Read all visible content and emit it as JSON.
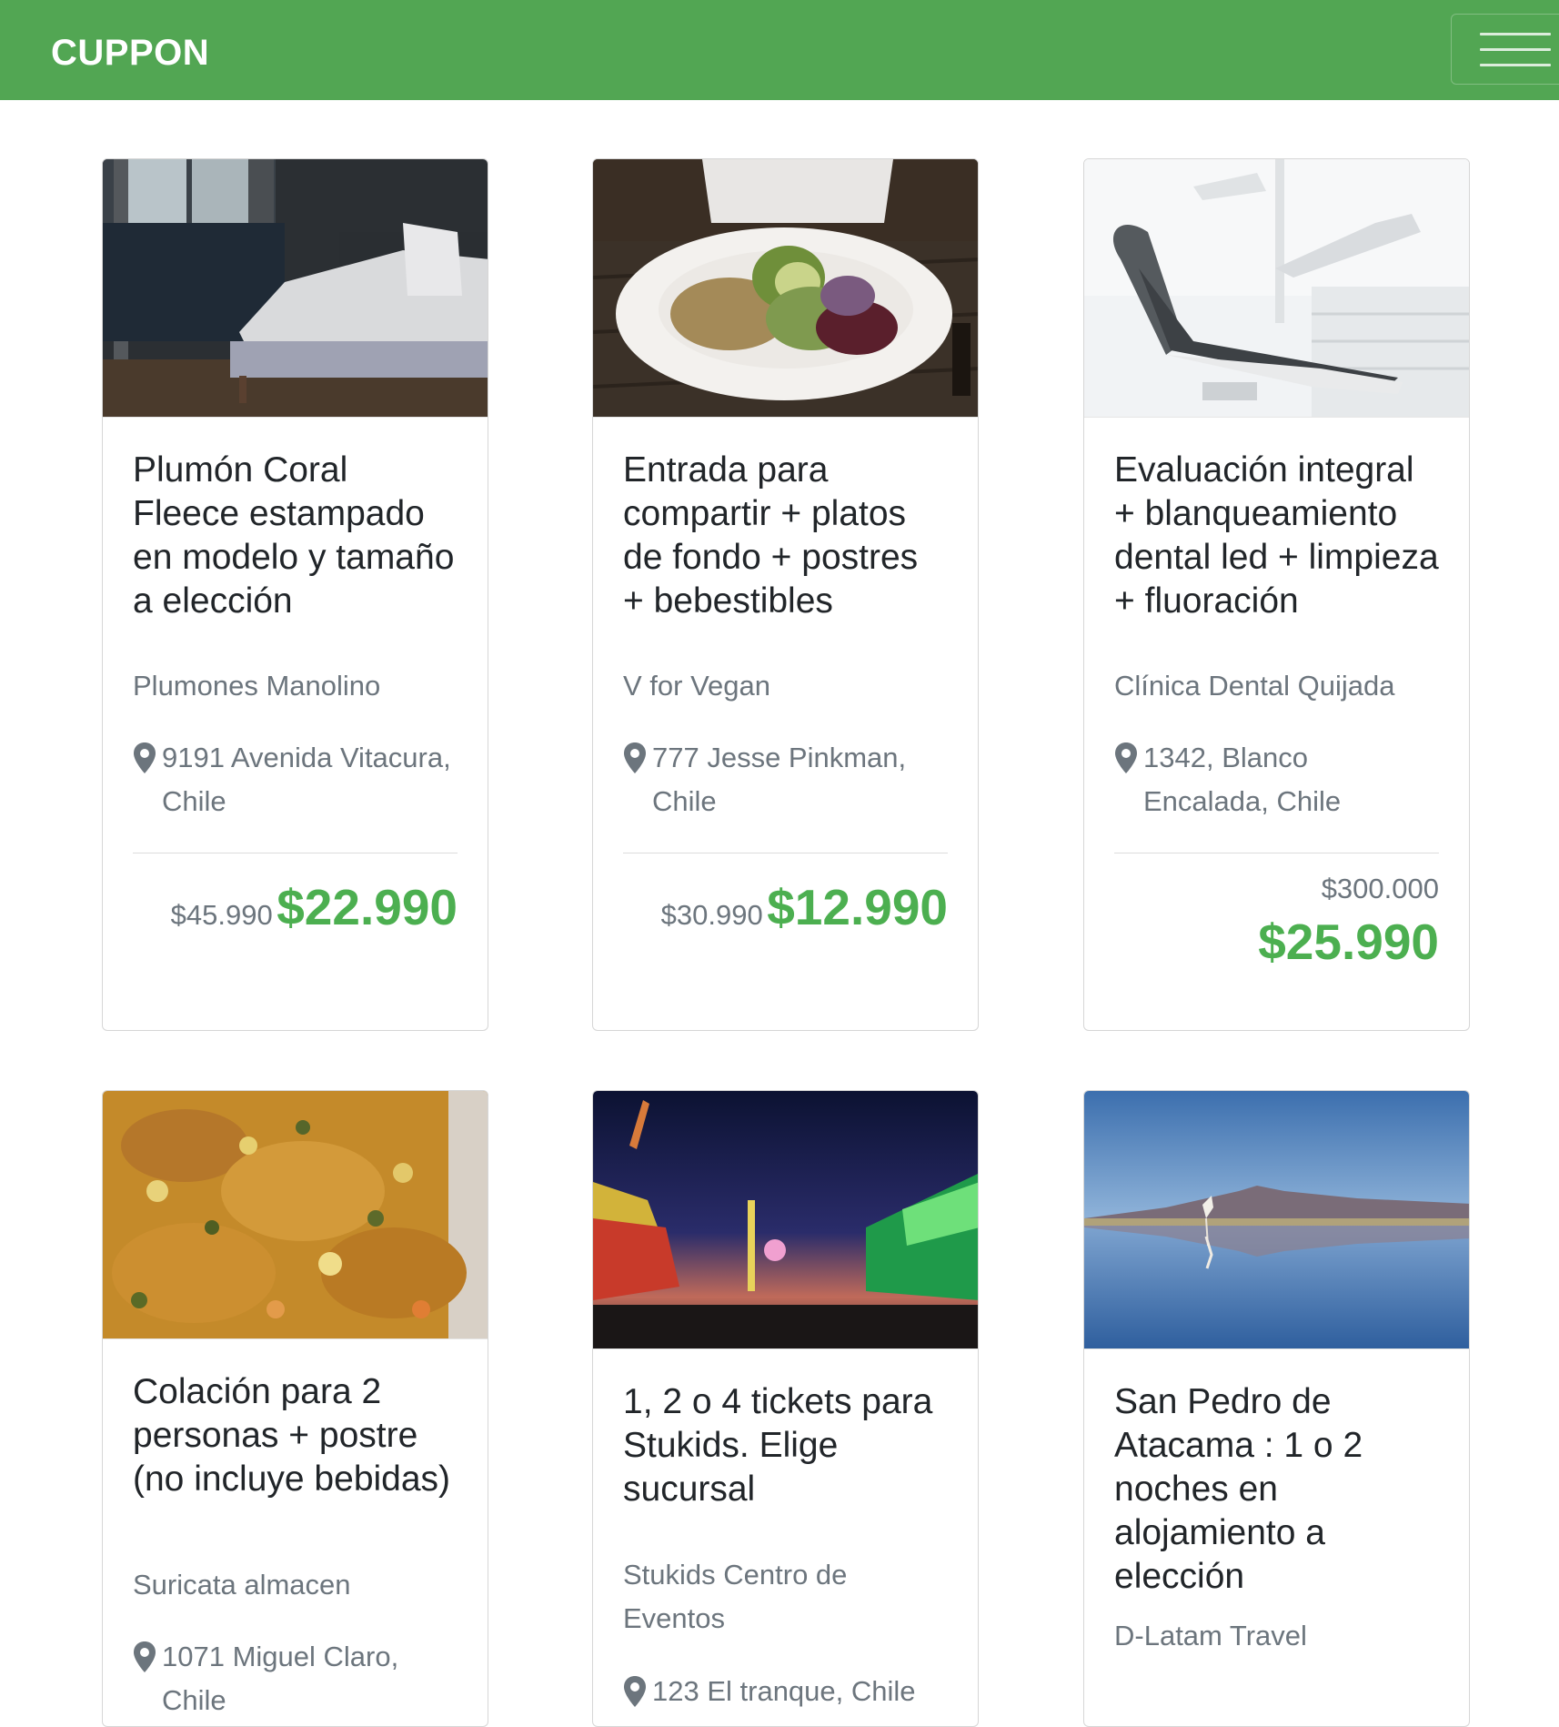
{
  "navbar": {
    "brand": "CUPPON",
    "menu_icon": "hamburger-icon",
    "color": "#52a653"
  },
  "accent_color": "#4caf50",
  "cards": [
    {
      "image": "bedroom-photo",
      "title": "Plumón Coral Fleece estampado en modelo y tamaño a elección",
      "merchant": "Plumones Manolino",
      "address": "9191 Avenida Vitacura, Chile",
      "old_price": "$45.990",
      "new_price": "$22.990"
    },
    {
      "image": "vegan-food-photo",
      "title": "Entrada para compartir + platos de fondo + postres + bebestibles",
      "merchant": "V for Vegan",
      "address": "777 Jesse Pinkman, Chile",
      "old_price": "$30.990",
      "new_price": "$12.990"
    },
    {
      "image": "dental-chair-photo",
      "title": "Evaluación integral + blanqueamiento dental led + limpieza + fluoración",
      "merchant": "Clínica Dental Quijada",
      "address": "1342, Blanco Encalada, Chile",
      "old_price": "$300.000",
      "new_price": "$25.990"
    },
    {
      "image": "food-dish-photo",
      "title": "Colación para 2 personas + postre (no incluye bebidas)",
      "merchant": "Suricata almacen",
      "address": "1071 Miguel Claro, Chile"
    },
    {
      "image": "amusement-park-photo",
      "title": "1, 2 o 4 tickets para Stukids. Elige sucursal",
      "merchant": "Stukids Centro de Eventos",
      "address": "123 El tranque, Chile"
    },
    {
      "image": "flamingo-lake-photo",
      "title": "San Pedro de Atacama : 1 o 2 noches en alojamiento a elección",
      "merchant": "D-Latam Travel"
    }
  ]
}
